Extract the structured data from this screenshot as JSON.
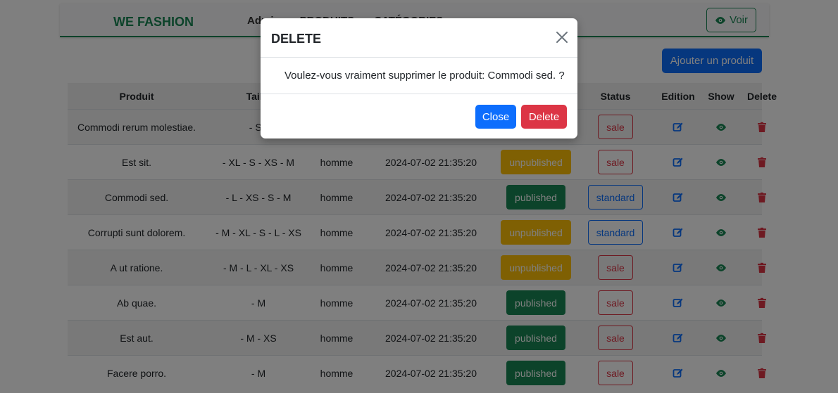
{
  "navbar": {
    "brand": "WE FASHION",
    "links": [
      "Admin",
      "PRODUITS",
      "CATÉGORIES"
    ],
    "voir_label": "Voir"
  },
  "add_button": "Ajouter un produit",
  "table": {
    "headers": [
      "Produit",
      "Taille",
      "",
      "",
      "",
      "Status",
      "Edition",
      "Show",
      "Delete"
    ],
    "rows": [
      {
        "name": "Commodi rerum molestiae.",
        "sizes": "- S -",
        "gender": "",
        "date": "",
        "publish": "",
        "status": "sale"
      },
      {
        "name": "Est sit.",
        "sizes": "- XL - S - XS - M",
        "gender": "homme",
        "date": "2024-07-02 21:35:20",
        "publish": "unpublished",
        "status": "sale"
      },
      {
        "name": "Commodi sed.",
        "sizes": "- L - XS - S - M",
        "gender": "homme",
        "date": "2024-07-02 21:35:20",
        "publish": "published",
        "status": "standard"
      },
      {
        "name": "Corrupti sunt dolorem.",
        "sizes": "- M - XL - S - L - XS",
        "gender": "homme",
        "date": "2024-07-02 21:35:20",
        "publish": "unpublished",
        "status": "standard"
      },
      {
        "name": "A ut ratione.",
        "sizes": "- M - L - XL - XS",
        "gender": "homme",
        "date": "2024-07-02 21:35:20",
        "publish": "unpublished",
        "status": "sale"
      },
      {
        "name": "Ab quae.",
        "sizes": "- M",
        "gender": "homme",
        "date": "2024-07-02 21:35:20",
        "publish": "published",
        "status": "sale"
      },
      {
        "name": "Est aut.",
        "sizes": "- M - XS",
        "gender": "homme",
        "date": "2024-07-02 21:35:20",
        "publish": "published",
        "status": "sale"
      },
      {
        "name": "Facere porro.",
        "sizes": "- M",
        "gender": "homme",
        "date": "2024-07-02 21:35:20",
        "publish": "published",
        "status": "sale"
      }
    ]
  },
  "modal": {
    "title": "DELETE",
    "message": "Voulez-vous vraiment supprimer le produit: Commodi sed. ?",
    "close_label": "Close",
    "delete_label": "Delete"
  },
  "colors": {
    "brand": "#198754",
    "primary": "#0d6efd",
    "danger": "#dc3545",
    "warning": "#ffc107"
  },
  "icons": {
    "edit": "edit-icon",
    "show": "eye-icon",
    "delete": "trash-icon",
    "close": "close-icon"
  }
}
